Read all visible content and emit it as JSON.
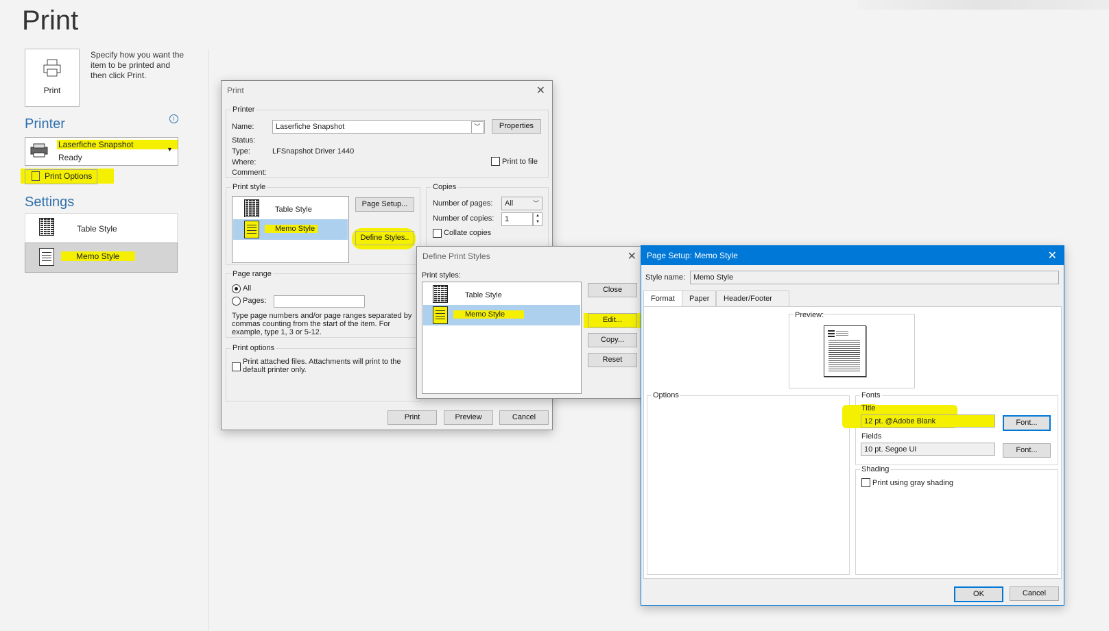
{
  "backstage": {
    "title": "Print",
    "print_button": "Print",
    "description": "Specify how you want the item to be printed and then click Print.",
    "printer_heading": "Printer",
    "printer_name": "Laserfiche Snapshot",
    "printer_status": "Ready",
    "print_options": "Print Options",
    "settings_heading": "Settings",
    "styles": [
      "Table Style",
      "Memo Style"
    ]
  },
  "print_dialog": {
    "title": "Print",
    "printer_group": "Printer",
    "name_label": "Name:",
    "name_value": "Laserfiche Snapshot",
    "properties": "Properties",
    "status_label": "Status:",
    "type_label": "Type:",
    "type_value": "LFSnapshot Driver 1440",
    "where_label": "Where:",
    "comment_label": "Comment:",
    "print_to_file": "Print to file",
    "print_style_group": "Print style",
    "styles": [
      "Table Style",
      "Memo Style"
    ],
    "page_setup": "Page Setup...",
    "define_styles": "Define Styles..",
    "copies_group": "Copies",
    "number_of_pages_label": "Number of pages:",
    "number_of_pages_value": "All",
    "number_of_copies_label": "Number of copies:",
    "number_of_copies_value": "1",
    "collate": "Collate copies",
    "page_range_group": "Page range",
    "all": "All",
    "pages": "Pages:",
    "range_help": "Type page numbers and/or page ranges separated by commas counting from the start of the item.  For example, type 1, 3 or 5-12.",
    "print_options_group": "Print options",
    "print_attached": "Print attached files.  Attachments will print to the default printer only.",
    "print_btn": "Print",
    "preview_btn": "Preview",
    "cancel_btn": "Cancel"
  },
  "define_dialog": {
    "title": "Define Print Styles",
    "label": "Print styles:",
    "styles": [
      "Table Style",
      "Memo Style"
    ],
    "close": "Close",
    "edit": "Edit...",
    "copy": "Copy...",
    "reset": "Reset"
  },
  "page_setup_dialog": {
    "title": "Page Setup: Memo Style",
    "style_name_label": "Style name:",
    "style_name_value": "Memo Style",
    "tabs": [
      "Format",
      "Paper",
      "Header/Footer"
    ],
    "preview_label": "Preview:",
    "options_group": "Options",
    "fonts_group": "Fonts",
    "title_label": "Title",
    "title_font": "12 pt. @Adobe Blank",
    "fields_label": "Fields",
    "fields_font": "10 pt. Segoe UI",
    "font_btn": "Font...",
    "shading_group": "Shading",
    "gray_shading": "Print using gray shading",
    "ok": "OK",
    "cancel": "Cancel"
  },
  "colors": {
    "accent": "#2e6fad",
    "highlight": "#f4f000",
    "selection": "#aed0ef",
    "titlebar_active": "#0078d7"
  }
}
